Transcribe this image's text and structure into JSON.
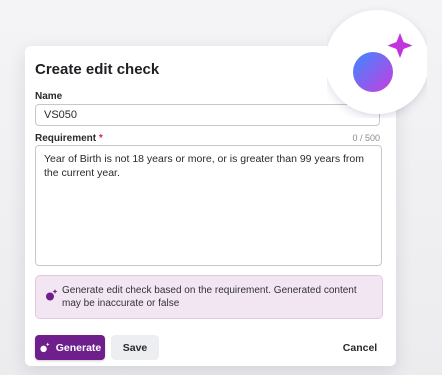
{
  "dialog": {
    "title": "Create edit check",
    "name_label": "Name",
    "name_value": "VS050",
    "requirement_label": "Requirement",
    "required_mark": "*",
    "char_count": "0 / 500",
    "requirement_value": "Year of Birth is not 18 years or more, or is greater than 99 years from the current year.",
    "notice": "Generate edit check based on the requirement. Generated content may be inaccurate or false",
    "generate_label": "Generate",
    "save_label": "Save",
    "cancel_label": "Cancel"
  },
  "icons": {
    "ai_badge": "ai-sparkle-icon",
    "notice": "ai-sparkle-icon",
    "generate": "ai-sparkle-icon"
  },
  "colors": {
    "primary": "#6e1f8c",
    "notice_bg": "#f3e6f3",
    "required": "#c8324a",
    "badge_gradient_start": "#3b8bff",
    "badge_gradient_end": "#c93be0"
  }
}
